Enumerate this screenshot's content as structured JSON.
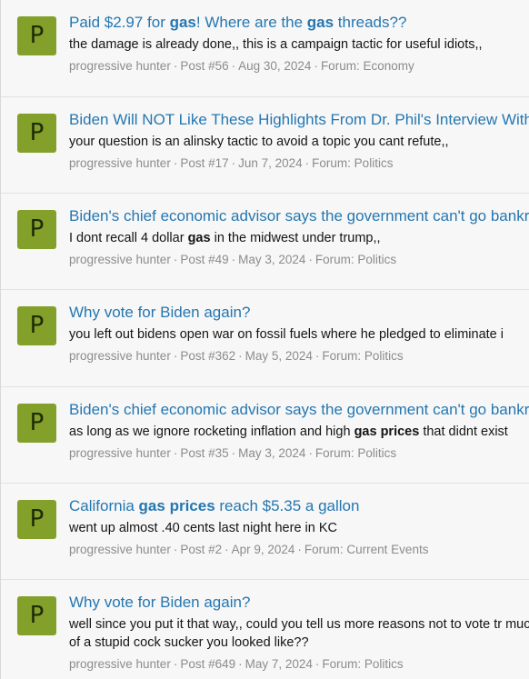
{
  "results": [
    {
      "avatar_letter": "P",
      "title_parts": [
        {
          "t": "Paid $2.97 for ",
          "b": false
        },
        {
          "t": "gas",
          "b": true
        },
        {
          "t": "! Where are the ",
          "b": false
        },
        {
          "t": "gas",
          "b": true
        },
        {
          "t": " threads??",
          "b": false
        }
      ],
      "snippet_parts": [
        {
          "t": "the damage is already done,, this is a campaign tactic for useful idiots,,",
          "b": false
        }
      ],
      "author": "progressive hunter",
      "post": "Post #56",
      "date": "Aug 30, 2024",
      "forum": "Forum: Economy"
    },
    {
      "avatar_letter": "P",
      "title_parts": [
        {
          "t": "Biden Will NOT Like These Highlights From Dr. Phil's Interview With",
          "b": false
        }
      ],
      "snippet_parts": [
        {
          "t": "your question is an alinsky tactic to avoid a topic you cant refute,,",
          "b": false
        }
      ],
      "author": "progressive hunter",
      "post": "Post #17",
      "date": "Jun 7, 2024",
      "forum": "Forum: Politics"
    },
    {
      "avatar_letter": "P",
      "title_parts": [
        {
          "t": "Biden's chief economic advisor says the government can't go bankr",
          "b": false
        }
      ],
      "snippet_parts": [
        {
          "t": "I dont recall 4 dollar ",
          "b": false
        },
        {
          "t": "gas",
          "b": true
        },
        {
          "t": " in the midwest under trump,,",
          "b": false
        }
      ],
      "author": "progressive hunter",
      "post": "Post #49",
      "date": "May 3, 2024",
      "forum": "Forum: Politics"
    },
    {
      "avatar_letter": "P",
      "title_parts": [
        {
          "t": "Why vote for Biden again?",
          "b": false
        }
      ],
      "snippet_parts": [
        {
          "t": "you left out bidens open war on fossil fuels where he pledged to eliminate i",
          "b": false
        }
      ],
      "author": "progressive hunter",
      "post": "Post #362",
      "date": "May 5, 2024",
      "forum": "Forum: Politics"
    },
    {
      "avatar_letter": "P",
      "title_parts": [
        {
          "t": "Biden's chief economic advisor says the government can't go bankr",
          "b": false
        }
      ],
      "snippet_parts": [
        {
          "t": "as long as we ignore rocketing inflation and high ",
          "b": false
        },
        {
          "t": "gas prices",
          "b": true
        },
        {
          "t": " that didnt exist",
          "b": false
        }
      ],
      "author": "progressive hunter",
      "post": "Post #35",
      "date": "May 3, 2024",
      "forum": "Forum: Politics"
    },
    {
      "avatar_letter": "P",
      "title_parts": [
        {
          "t": "California ",
          "b": false
        },
        {
          "t": "gas prices",
          "b": true
        },
        {
          "t": " reach $5.35 a gallon",
          "b": false
        }
      ],
      "snippet_parts": [
        {
          "t": "went up almost .40 cents last night here in KC",
          "b": false
        }
      ],
      "author": "progressive hunter",
      "post": "Post #2",
      "date": "Apr 9, 2024",
      "forum": "Forum: Current Events"
    },
    {
      "avatar_letter": "P",
      "title_parts": [
        {
          "t": "Why vote for Biden again?",
          "b": false
        }
      ],
      "snippet_parts": [
        {
          "t": "well since you put it that way,, could you tell us more reasons not to vote tr much of a stupid cock sucker you looked like??",
          "b": false
        }
      ],
      "author": "progressive hunter",
      "post": "Post #649",
      "date": "May 7, 2024",
      "forum": "Forum: Politics"
    }
  ]
}
